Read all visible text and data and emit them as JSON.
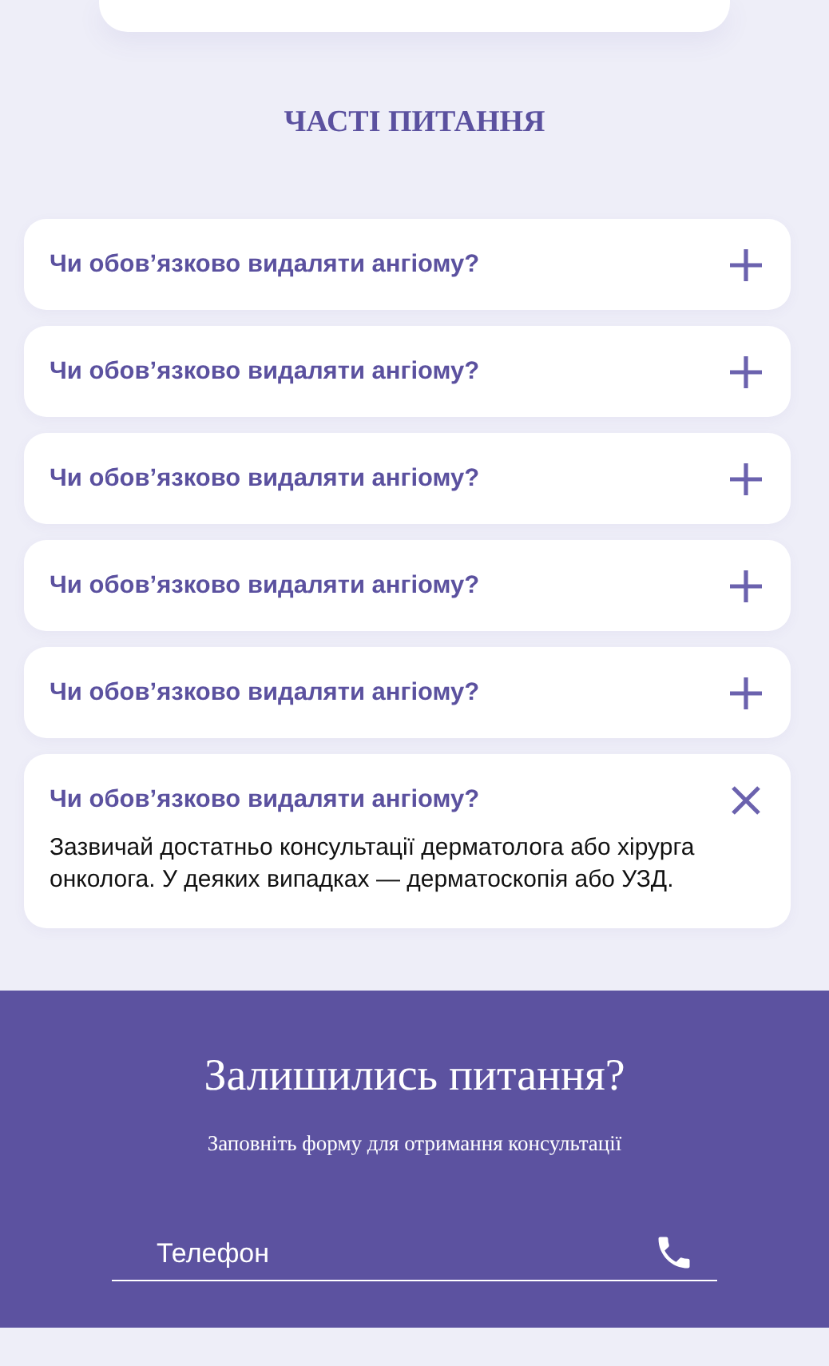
{
  "faq": {
    "title": "ЧАСТІ ПИТАННЯ",
    "items": [
      {
        "question": "Чи обов’язково видаляти ангіому?",
        "expanded": false
      },
      {
        "question": "Чи обов’язково видаляти ангіому?",
        "expanded": false
      },
      {
        "question": "Чи обов’язково видаляти ангіому?",
        "expanded": false
      },
      {
        "question": "Чи обов’язково видаляти ангіому?",
        "expanded": false
      },
      {
        "question": "Чи обов’язково видаляти ангіому?",
        "expanded": false
      },
      {
        "question": "Чи обов’язково видаляти ангіому?",
        "expanded": true,
        "answer": "Зазвичай достатньо консультації дерматолога або хірурга онколога. У деяких випадках — дерматоскопія або УЗД."
      }
    ]
  },
  "contact": {
    "title": "Залишились питання?",
    "subtitle": "Заповніть форму для отримання консультації",
    "phone_field": {
      "placeholder": "Телефон"
    }
  }
}
